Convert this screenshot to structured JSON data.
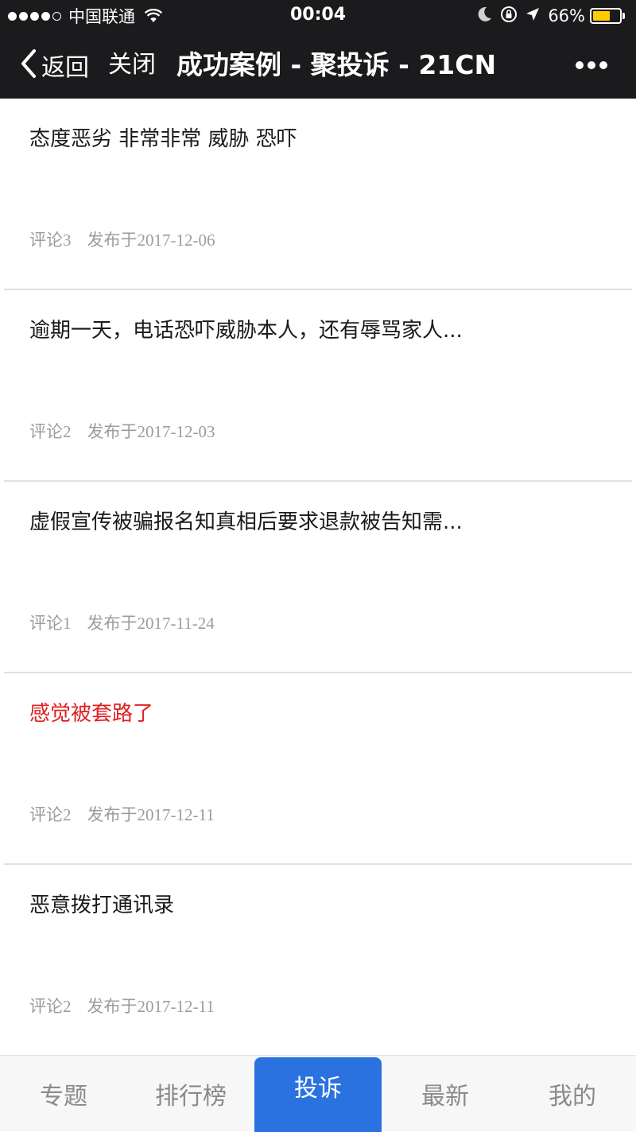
{
  "status_bar": {
    "carrier": "中国联通",
    "time": "00:04",
    "battery_percent": "66%",
    "battery_level": 0.66,
    "signal_bars": 4,
    "signal_max": 5
  },
  "nav": {
    "back_label": "返回",
    "close_label": "关闭",
    "title": "成功案例 - 聚投诉 - 21CN"
  },
  "cases": [
    {
      "title": "态度恶劣 非常非常 威胁 恐吓",
      "comments": "评论3",
      "date": "发布于2017-12-06",
      "highlight": false
    },
    {
      "title": "逾期一天，电话恐吓威胁本人，还有辱骂家人...",
      "comments": "评论2",
      "date": "发布于2017-12-03",
      "highlight": false
    },
    {
      "title": "虚假宣传被骗报名知真相后要求退款被告知需...",
      "comments": "评论1",
      "date": "发布于2017-11-24",
      "highlight": false
    },
    {
      "title": "感觉被套路了",
      "comments": "评论2",
      "date": "发布于2017-12-11",
      "highlight": true
    },
    {
      "title": "恶意拨打通讯录",
      "comments": "评论2",
      "date": "发布于2017-12-11",
      "highlight": false
    }
  ],
  "tabs": [
    {
      "label": "专题",
      "active": false
    },
    {
      "label": "排行榜",
      "active": false
    },
    {
      "label": "投诉",
      "active": true
    },
    {
      "label": "最新",
      "active": false
    },
    {
      "label": "我的",
      "active": false
    }
  ],
  "colors": {
    "nav_background": "#1b1b1d",
    "highlight_title": "#e02020",
    "meta_text": "#9c9c9c",
    "active_tab": "#2a72e0",
    "battery_fill": "#ffcc00"
  }
}
